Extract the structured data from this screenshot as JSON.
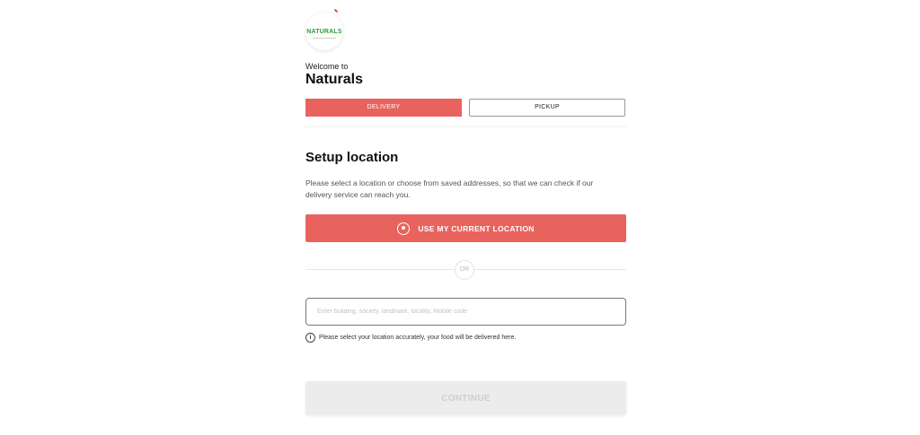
{
  "header": {
    "logo_text": "NATURALS",
    "welcome": "Welcome to",
    "brand": "Naturals"
  },
  "tabs": [
    {
      "label": "DELIVERY",
      "active": true
    },
    {
      "label": "PICKUP",
      "active": false
    }
  ],
  "location": {
    "title": "Setup location",
    "description": "Please select a location or choose from saved addresses, so that we can check if our delivery service can reach you.",
    "use_current_label": "USE MY CURRENT LOCATION",
    "or_label": "OR",
    "search_placeholder": "Enter building, society, landmark, locality, Mobile code",
    "search_value": "",
    "hint": "Please select your location accurately, your food will be delivered here.",
    "continue_label": "CONTINUE"
  },
  "colors": {
    "accent": "#e8635e",
    "logo_green": "#2e9b3a",
    "disabled_bg": "#ececec"
  },
  "icons": {
    "location": "current-location-icon",
    "info": "info-icon"
  }
}
